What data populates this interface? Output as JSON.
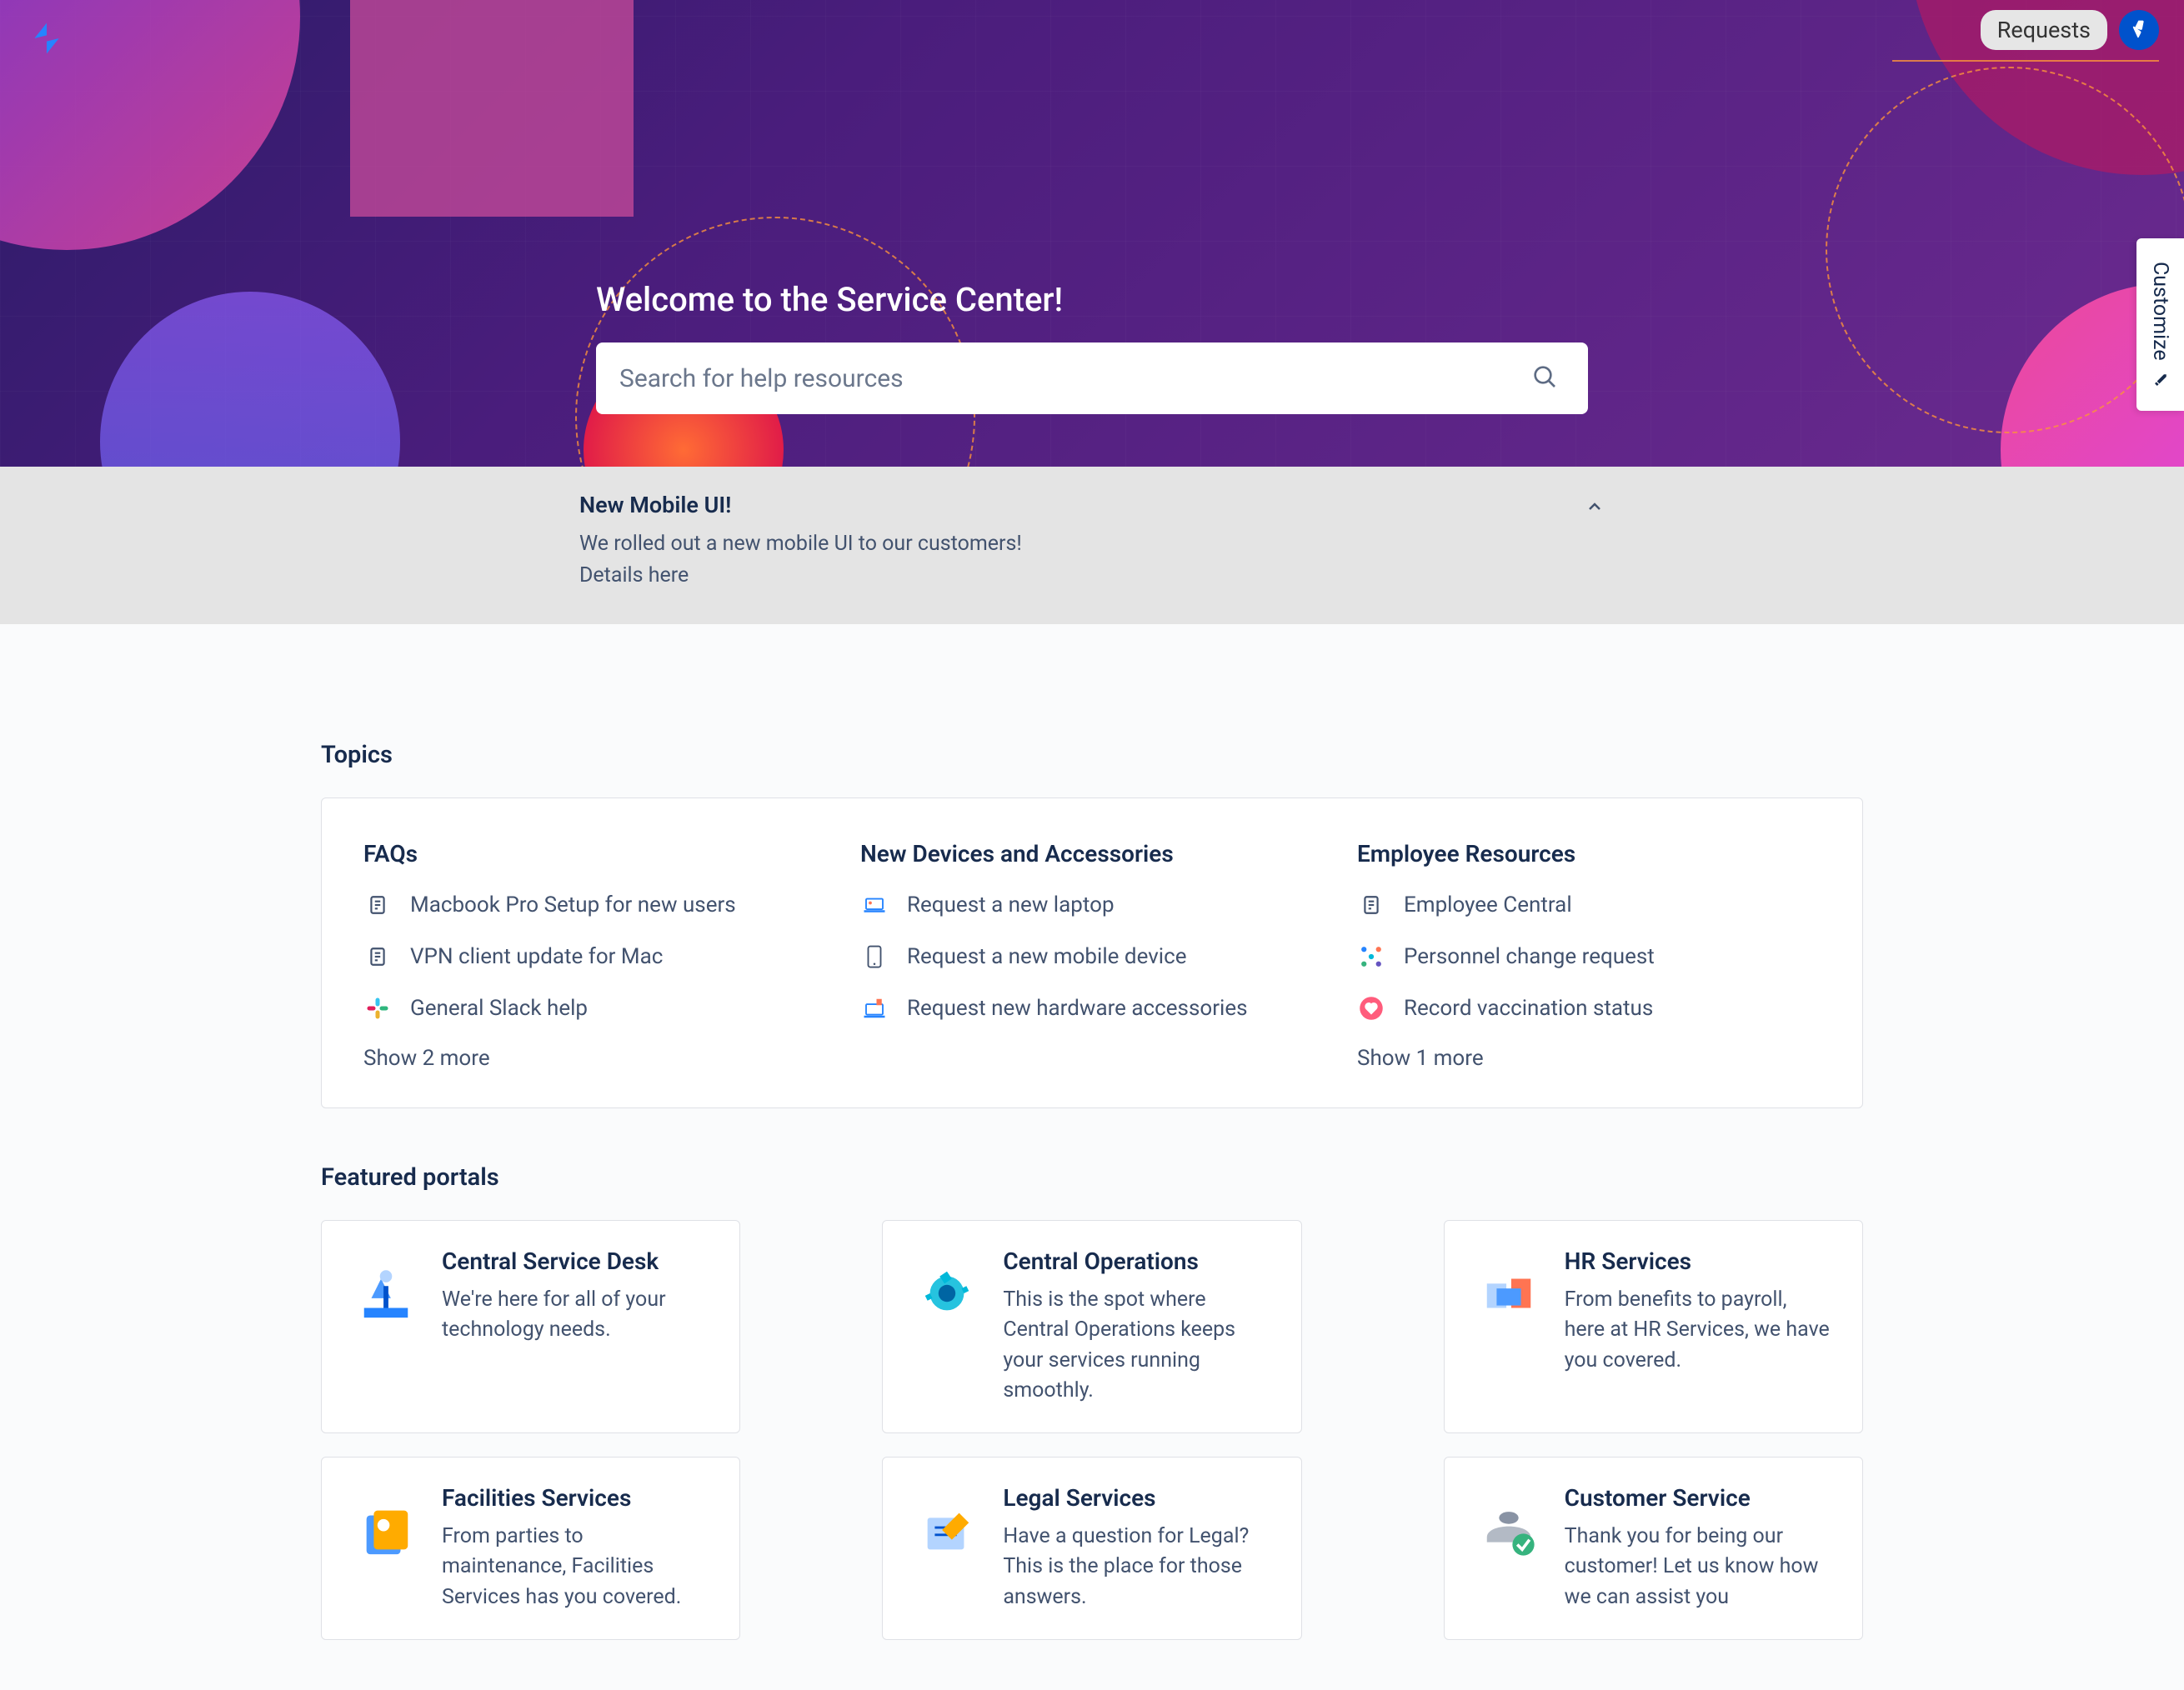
{
  "header": {
    "requests_label": "Requests"
  },
  "customize_label": "Customize",
  "hero": {
    "title": "Welcome to the Service Center!",
    "search_placeholder": "Search for help resources"
  },
  "announcement": {
    "title": "New Mobile UI!",
    "line1": "We rolled out a new mobile UI to our customers!",
    "line2": "Details here"
  },
  "topics": {
    "heading": "Topics",
    "columns": [
      {
        "title": "FAQs",
        "items": [
          {
            "label": "Macbook Pro Setup for new users",
            "icon": "doc"
          },
          {
            "label": "VPN client update for Mac",
            "icon": "doc"
          },
          {
            "label": "General Slack help",
            "icon": "slack"
          }
        ],
        "show_more": "Show 2 more"
      },
      {
        "title": "New Devices and Accessories",
        "items": [
          {
            "label": "Request a new laptop",
            "icon": "laptop"
          },
          {
            "label": "Request a new mobile device",
            "icon": "phone"
          },
          {
            "label": "Request new hardware accessories",
            "icon": "hardware"
          }
        ],
        "show_more": ""
      },
      {
        "title": "Employee Resources",
        "items": [
          {
            "label": "Employee Central",
            "icon": "doc"
          },
          {
            "label": "Personnel change request",
            "icon": "dots"
          },
          {
            "label": "Record vaccination status",
            "icon": "heart"
          }
        ],
        "show_more": "Show 1 more"
      }
    ]
  },
  "portals": {
    "heading": "Featured portals",
    "cards": [
      {
        "title": "Central Service Desk",
        "desc": "We're here for all of your technology needs."
      },
      {
        "title": "Central Operations",
        "desc": "This is the spot where Central Operations keeps your services running smoothly."
      },
      {
        "title": "HR Services",
        "desc": "From benefits to payroll, here at HR Services, we have you covered."
      },
      {
        "title": "Facilities Services",
        "desc": "From parties to maintenance, Facilities Services has you covered."
      },
      {
        "title": "Legal Services",
        "desc": "Have a question for Legal? This is the place for those answers."
      },
      {
        "title": "Customer Service",
        "desc": "Thank you for being our customer! Let us know how we can assist you"
      }
    ]
  }
}
